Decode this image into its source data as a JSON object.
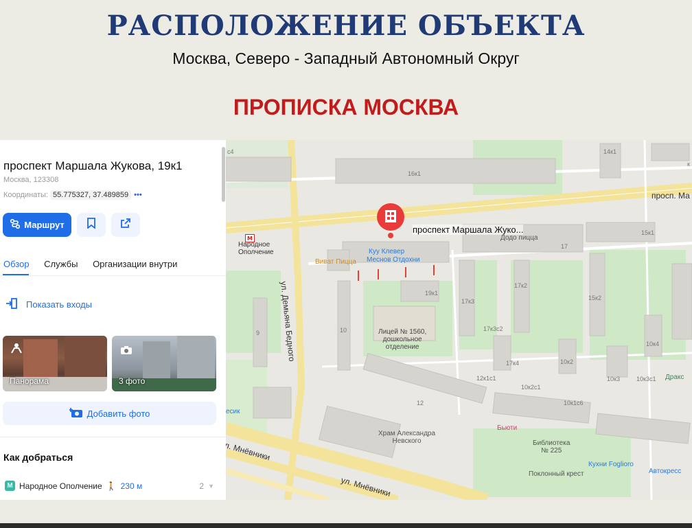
{
  "header": {
    "title": "РАСПОЛОЖЕНИЕ ОБЪЕКТА",
    "subtitle": "Москва, Северо  - Западный Автономный Округ",
    "tagline": "ПРОПИСКА МОСКВА"
  },
  "panel": {
    "address": "проспект Маршала Жукова, 19к1",
    "city_line": "Москва, 123308",
    "coords_label": "Координаты:",
    "coords_value": "55.775327, 37.489859",
    "coords_more": "•••",
    "route_label": "Маршрут",
    "tabs": [
      "Обзор",
      "Службы",
      "Организации внутри"
    ],
    "show_entrances": "Показать входы",
    "photos": [
      {
        "label": "Панорама",
        "icon": "panorama-icon"
      },
      {
        "label": "3 фото",
        "icon": "camera-icon"
      }
    ],
    "add_photo": "Добавить фото",
    "how_to_get": "Как добраться",
    "metro": {
      "badge": "M",
      "station": "Народное Ополчение",
      "walk": "230 м",
      "count": "2"
    }
  },
  "map": {
    "pin_label": "проспект Маршала Жуко...",
    "streets": {
      "demyana": "ул. Демьяна Бедного",
      "mnevniki1": "л. Мнёвники",
      "mnevniki2": "ул. Мнёвники",
      "prosp": "просп. Ма"
    },
    "metro_label": "Народное\nОполчение",
    "pois": {
      "pizza": "Виват Пицца",
      "kuu": "Куу  Клевер",
      "mesnov": "Меснов Отдохни",
      "dodo": "Додо пицца",
      "lyceum": "Лицей № 1560,\nдошкольное\nотделение",
      "church": "Храм Александра\nНевского",
      "beauty": "Бьюти",
      "library": "Библиотека\n№ 225",
      "poklonny": "Поклонный крест",
      "kitchen": "Кухни Foglioro",
      "autokress": "Автокресс",
      "drax": "Дракс",
      "esik": "есик"
    },
    "buildings": [
      "16к1",
      "14к1",
      "15к1",
      "17",
      "19к1",
      "17к2",
      "17к3",
      "15к2",
      "17к3с2",
      "10",
      "9",
      "17к4",
      "10к2",
      "10к3",
      "10к3с1",
      "10к4",
      "12к1с1",
      "10к2с1",
      "10к1с6",
      "12",
      "с4",
      "к"
    ]
  }
}
